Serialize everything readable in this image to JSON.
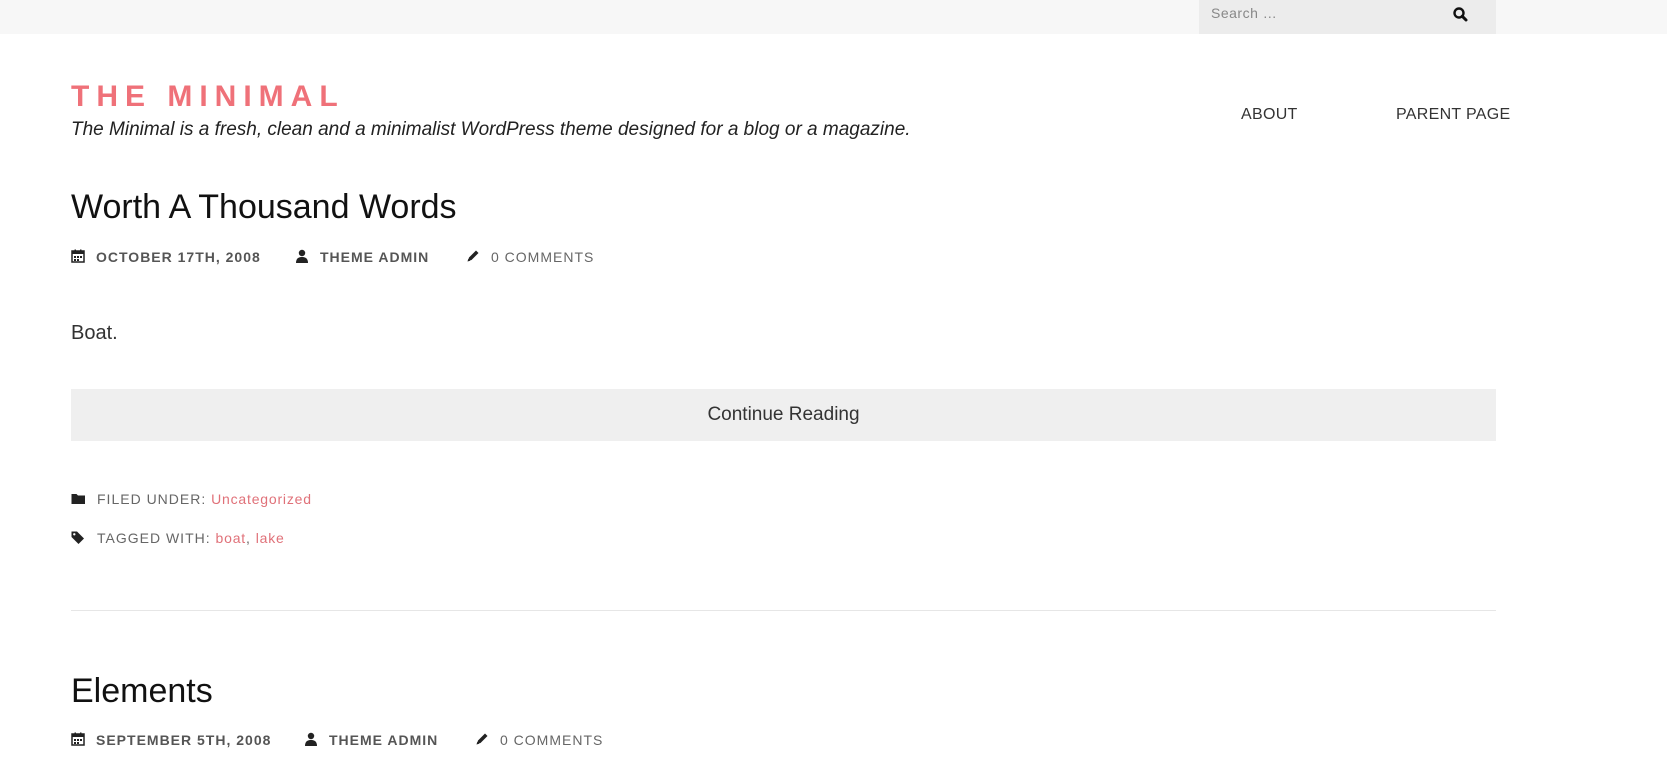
{
  "search": {
    "placeholder": "Search …",
    "icon": "search-icon"
  },
  "site": {
    "title": "THE MINIMAL",
    "tagline": "The Minimal is a fresh, clean and a minimalist WordPress theme designed for a blog or a magazine.",
    "accent_color": "#ef7179"
  },
  "nav": {
    "items": [
      {
        "label": "ABOUT"
      },
      {
        "label": "PARENT PAGE"
      }
    ]
  },
  "posts": [
    {
      "title": "Worth A Thousand Words",
      "date": "OCTOBER 17TH, 2008",
      "author": "THEME ADMIN",
      "comments": "0 COMMENTS",
      "excerpt": "Boat.",
      "continue_label": "Continue Reading",
      "filed_label": "FILED UNDER:",
      "category": "Uncategorized",
      "tagged_label": "TAGGED WITH:",
      "tags": [
        "boat",
        "lake"
      ],
      "tag_separator": ","
    },
    {
      "title": "Elements",
      "date": "SEPTEMBER 5TH, 2008",
      "author": "THEME ADMIN",
      "comments": "0 COMMENTS"
    }
  ]
}
